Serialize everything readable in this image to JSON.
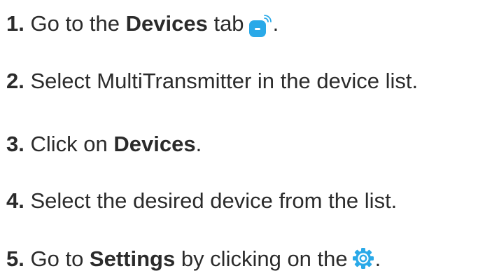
{
  "steps": [
    {
      "num": "1.",
      "t1": "Go to the ",
      "b1": "Devices",
      "t2": " tab",
      "icon": "devices-tab-icon",
      "t3": "."
    },
    {
      "num": "2.",
      "t1": "Select MultiTransmitter in the device list."
    },
    {
      "num": "3.",
      "t1": "Click on ",
      "b1": "Devices",
      "t2": "."
    },
    {
      "num": "4.",
      "t1": "Select the desired device from the list."
    },
    {
      "num": "5.",
      "t1": "Go to ",
      "b1": "Settings",
      "t2": " by clicking on the",
      "icon": "settings-gear-icon",
      "t3": "."
    }
  ],
  "colors": {
    "text": "#2b2b2b",
    "accent": "#2aa9e8"
  }
}
